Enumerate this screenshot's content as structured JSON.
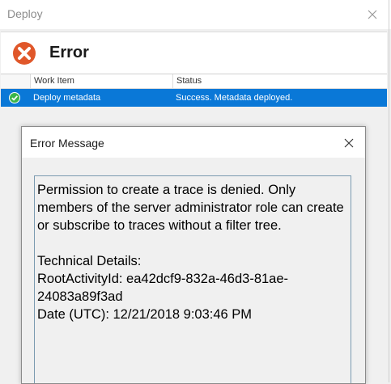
{
  "window": {
    "title": "Deploy"
  },
  "header": {
    "title": "Error"
  },
  "grid": {
    "columns": [
      "Work Item",
      "Status"
    ],
    "rows": [
      {
        "work_item": "Deploy metadata",
        "status": "Success. Metadata deployed."
      }
    ]
  },
  "dialog": {
    "title": "Error Message",
    "message": "Permission to create a trace is denied. Only members of the server administrator role can create or subscribe to traces without a filter tree.\n\nTechnical Details:\nRootActivityId: ea42dcf9-832a-46d3-81ae-24083a89f3ad\nDate (UTC): 12/21/2018 9:03:46 PM"
  },
  "colors": {
    "selection": "#0a78d7",
    "error_icon": "#e0572a",
    "success_icon": "#3bb54a"
  },
  "icons": [
    "close-icon",
    "error-icon",
    "success-check-icon"
  ]
}
